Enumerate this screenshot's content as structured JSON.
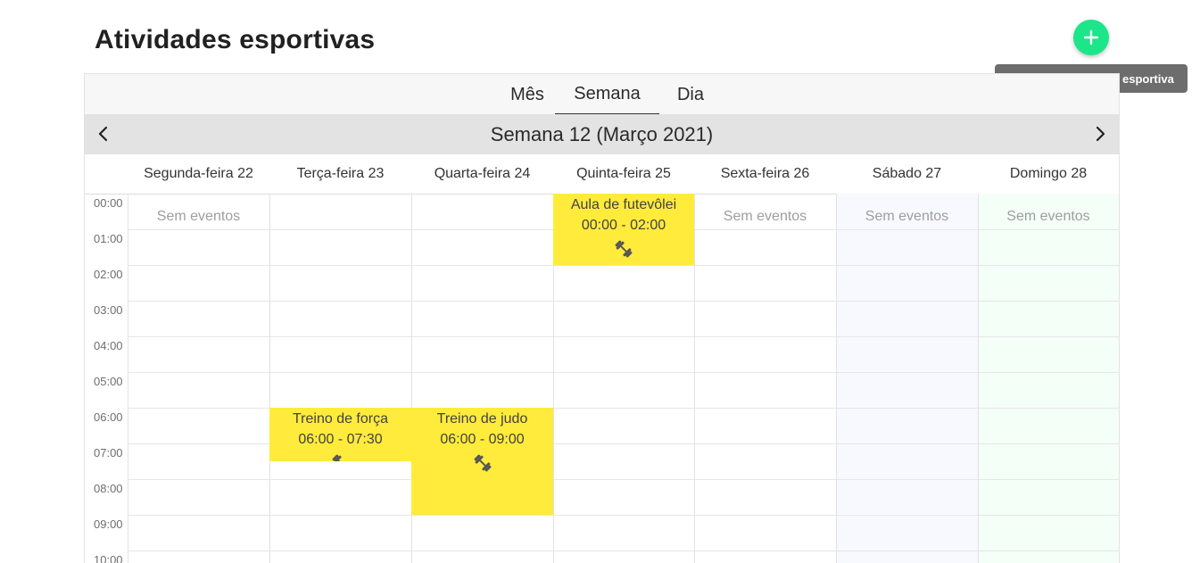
{
  "page": {
    "title": "Atividades esportivas"
  },
  "fab": {
    "icon": "plus-icon",
    "tooltip": "Criar nova atividade esportiva",
    "color": "#1de58a"
  },
  "tabs": [
    {
      "label": "Mês",
      "active": false
    },
    {
      "label": "Semana",
      "active": true
    },
    {
      "label": "Dia",
      "active": false
    }
  ],
  "navigation": {
    "title": "Semana 12 (Março 2021)",
    "prev_icon": "chevron-left-icon",
    "next_icon": "chevron-right-icon"
  },
  "days": [
    {
      "label": "Segunda-feira 22",
      "no_events": "Sem eventos"
    },
    {
      "label": "Terça-feira 23",
      "no_events": ""
    },
    {
      "label": "Quarta-feira 24",
      "no_events": ""
    },
    {
      "label": "Quinta-feira 25",
      "no_events": ""
    },
    {
      "label": "Sexta-feira 26",
      "no_events": "Sem eventos"
    },
    {
      "label": "Sábado 27",
      "no_events": "Sem eventos"
    },
    {
      "label": "Domingo 28",
      "no_events": "Sem eventos"
    }
  ],
  "hours": [
    "00:00",
    "01:00",
    "02:00",
    "03:00",
    "04:00",
    "05:00",
    "06:00",
    "07:00",
    "08:00",
    "09:00",
    "10:00"
  ],
  "events": [
    {
      "title": "Treino de força",
      "time": "06:00 - 07:30",
      "icon": "dumbbell-icon"
    },
    {
      "title": "Treino de judo",
      "time": "06:00 - 09:00",
      "icon": "dumbbell-icon"
    },
    {
      "title": "Aula de futevôlei",
      "time": "00:00 - 02:00",
      "icon": "dumbbell-icon"
    }
  ],
  "colors": {
    "event": "#ffeb3b",
    "saturday": "#f8f8ff",
    "sunday": "#f4fff8",
    "accent": "#1de58a"
  }
}
